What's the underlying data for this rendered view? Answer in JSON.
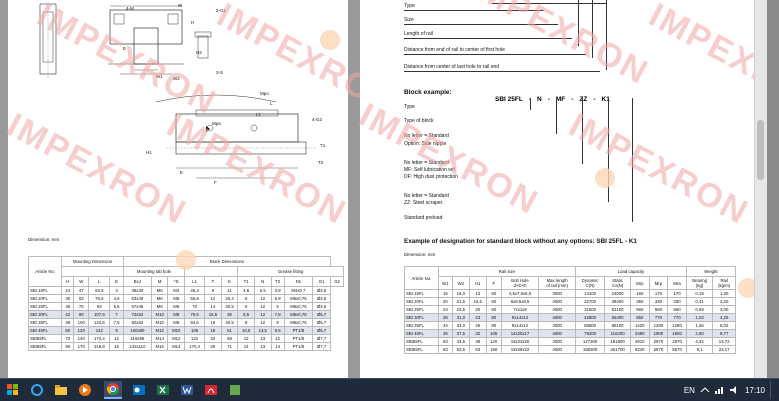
{
  "left_page": {
    "dimension_note": "Dimension: mm",
    "top_drawing_labels": [
      "4-M",
      "W",
      "2-G1",
      "H",
      "E",
      "H2",
      "W1",
      "W2",
      "H3",
      "W2",
      "3-S"
    ],
    "side_drawing_labels": [
      "Mpo",
      "L",
      "L1",
      "4-G2",
      "Mpa",
      "H1",
      "H",
      "T1",
      "T2",
      "E",
      "F"
    ],
    "group_headers": {
      "article": "Article No.",
      "mounting": "Mounting Dimension",
      "block": "Block Dimensions",
      "tab": "Mounting tab hole",
      "grease": "Grease fitting"
    },
    "col_headers": [
      "H",
      "W",
      "L",
      "E",
      "BxJ",
      "M",
      "*S",
      "L1",
      "T",
      "K",
      "T1",
      "N",
      "T2",
      "N1",
      "G1",
      "G2"
    ],
    "rows": [
      [
        "SBI 15FL",
        "24",
        "47",
        "63,8",
        "3",
        "38x30",
        "M5",
        "M4",
        "45,2",
        "9",
        "21",
        "4,5",
        "5,5",
        "3,8",
        "M4x0,7",
        "Ø3,5"
      ],
      [
        "SBI 20FL",
        "30",
        "63",
        "78,8",
        "4,6",
        "53x40",
        "M6",
        "M5",
        "56,8",
        "12",
        "25,4",
        "6",
        "12",
        "5,8",
        "M6x0,75",
        "Ø3,5"
      ],
      [
        "SBI 25FL",
        "36",
        "70",
        "92",
        "5,5",
        "57x45",
        "M8",
        "M6",
        "70",
        "14",
        "30,5",
        "6",
        "12",
        "5",
        "M6x0,75",
        "Ø3,5"
      ],
      [
        "SBI 30FL",
        "42",
        "90",
        "107,6",
        "7",
        "72x52",
        "M10",
        "M8",
        "79,6",
        "15,5",
        "35",
        "8,5",
        "12",
        "7,8",
        "M6x0,75",
        "Ø5,7"
      ],
      [
        "SBI 35FL",
        "48",
        "100",
        "124,6",
        "7,5",
        "82x62",
        "M10",
        "M8",
        "94,6",
        "18",
        "40,5",
        "8",
        "12",
        "8",
        "M6x0,75",
        "Ø5,7"
      ],
      [
        "SBI 45FL",
        "60",
        "120",
        "142",
        "9",
        "100x80",
        "M12",
        "M10",
        "108",
        "18",
        "51",
        "10,5",
        "13,5",
        "9,5",
        "PT1/8",
        "Ø5,7"
      ],
      [
        "SBI55FL",
        "70",
        "140",
        "172,4",
        "12",
        "116x95",
        "M14",
        "M12",
        "131",
        "22",
        "58",
        "12",
        "13",
        "12",
        "PT1/8",
        "Ø7,7"
      ],
      [
        "SBI65FL",
        "90",
        "170",
        "219,8",
        "15",
        "142x110",
        "M16",
        "M14",
        "170,4",
        "26",
        "71",
        "14",
        "13",
        "14",
        "PT1/8",
        "Ø7,7"
      ]
    ]
  },
  "right_page": {
    "top_list": [
      "Type",
      "Size",
      "Length of rail",
      "Distance from end of rail to center of first hole",
      "Distance from center of last hole to rail end"
    ],
    "block_example_label": "Block example:",
    "block_example_code": [
      "SBI 25FL",
      "-",
      "N",
      "-",
      "MF",
      "-",
      "ZZ",
      "-",
      "K1"
    ],
    "block_items": [
      "Type",
      "Type of block",
      "No letter = Standard",
      "Option: Side nipple",
      "No letter = Standard",
      "MF: Self lubrication set",
      "DF: High dust protection",
      "No letter = Standard",
      "ZZ: Steel scraper.",
      "Standard preload"
    ],
    "designation_title": "Example of designation for standard block without any options: SBI 25FL - K1",
    "dimension_note": "Dimension: mm",
    "group_headers": {
      "article": "Article No.",
      "rail": "Rail size",
      "load": "Load capacity",
      "weight": "Weight",
      "static_moment": "Static moment (Nm)"
    },
    "col_headers": [
      "W1",
      "W2",
      "H1",
      "F",
      "Bolt Hole\nd×D×h",
      "Max length\nof rail (mm)",
      "Dynamic\nC(N)",
      "Static\nCo(N)",
      "Mrp",
      "Mrp",
      "Mra",
      "Bearing\n(kg)",
      "Rail\n(kg/m)"
    ],
    "rows": [
      [
        "SBI 15FL",
        "15",
        "16,0",
        "13",
        "60",
        "4,5x7,5x5,5",
        "3000",
        "14100",
        "24000",
        "160",
        "170",
        "170",
        "0,19",
        "1,30"
      ],
      [
        "SBI 20FL",
        "20",
        "21,5",
        "16,5",
        "60",
        "6x9,5x8,5",
        "4000",
        "22700",
        "38400",
        "360",
        "330",
        "330",
        "0,41",
        "2,20"
      ],
      [
        "SBI 25FL",
        "23",
        "23,5",
        "20",
        "60",
        "7x11x9",
        "4000",
        "31500",
        "52100",
        "560",
        "560",
        "560",
        "0,69",
        "3,00"
      ],
      [
        "SBI 30FL",
        "28",
        "31,0",
        "23",
        "80",
        "9x14x12",
        "4000",
        "42800",
        "65400",
        "850",
        "770",
        "770",
        "1,04",
        "4,25"
      ],
      [
        "SBI 35FL",
        "34",
        "33,0",
        "26",
        "80",
        "9x14x12",
        "4000",
        "55600",
        "85100",
        "1420",
        "1280",
        "1280",
        "1,56",
        "6,02"
      ],
      [
        "SBI 45FL",
        "45",
        "37,5",
        "32",
        "105",
        "14x20x17",
        "4000",
        "79200",
        "116300",
        "2490",
        "1900",
        "1900",
        "2,80",
        "9,77"
      ],
      [
        "SBI55FL",
        "53",
        "43,5",
        "38",
        "120",
        "16x23x20",
        "4000",
        "127300",
        "181800",
        "4810",
        "2970",
        "2970",
        "4,42",
        "13,72"
      ],
      [
        "SBI65FL",
        "63",
        "53,5",
        "53",
        "150",
        "18x26x22",
        "4000",
        "188300",
        "261700",
        "8240",
        "5570",
        "5570",
        "9,1",
        "23,17"
      ]
    ]
  },
  "watermark": {
    "text": "IMPEXRON",
    "color": "#f2a7a7"
  },
  "taskbar": {
    "lang": "EN",
    "clock": "17:10"
  }
}
